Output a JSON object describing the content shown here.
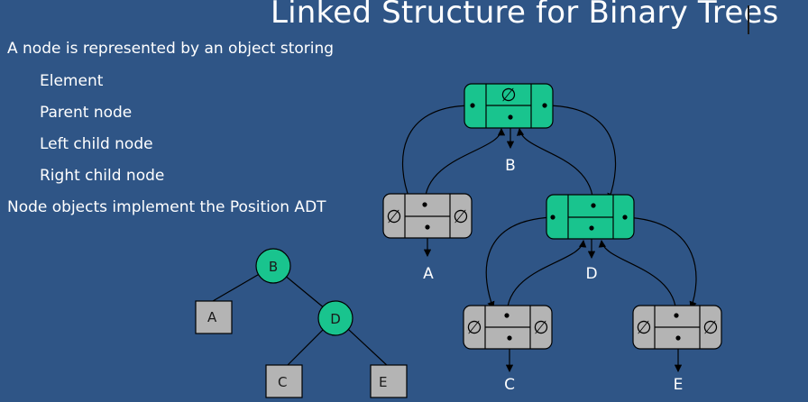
{
  "title": "Linked Structure for Binary Trees",
  "bullets": [
    "A node is represented by an object storing",
    "Element",
    "Parent node",
    "Left child node",
    "Right child node",
    "Node objects implement the Position ADT"
  ],
  "null_symbol": "∅",
  "colors": {
    "background": "#2f5586",
    "internal_node": "#19c48e",
    "external_node": "#b4b4b4",
    "outline": "#000000",
    "text": "#ffffff"
  },
  "small_tree": {
    "nodes": [
      {
        "label": "B",
        "kind": "internal"
      },
      {
        "label": "A",
        "kind": "external"
      },
      {
        "label": "D",
        "kind": "internal"
      },
      {
        "label": "C",
        "kind": "external"
      },
      {
        "label": "E",
        "kind": "external"
      }
    ],
    "edges": [
      [
        "B",
        "A"
      ],
      [
        "B",
        "D"
      ],
      [
        "D",
        "C"
      ],
      [
        "D",
        "E"
      ]
    ]
  },
  "linked_structure": {
    "nodes": [
      {
        "label": "B",
        "kind": "internal",
        "parent": "∅",
        "left": "",
        "right": ""
      },
      {
        "label": "A",
        "kind": "external",
        "parent": "",
        "left": "∅",
        "right": "∅"
      },
      {
        "label": "D",
        "kind": "internal",
        "parent": "",
        "left": "",
        "right": ""
      },
      {
        "label": "C",
        "kind": "external",
        "parent": "",
        "left": "∅",
        "right": "∅"
      },
      {
        "label": "E",
        "kind": "external",
        "parent": "",
        "left": "∅",
        "right": "∅"
      }
    ]
  }
}
